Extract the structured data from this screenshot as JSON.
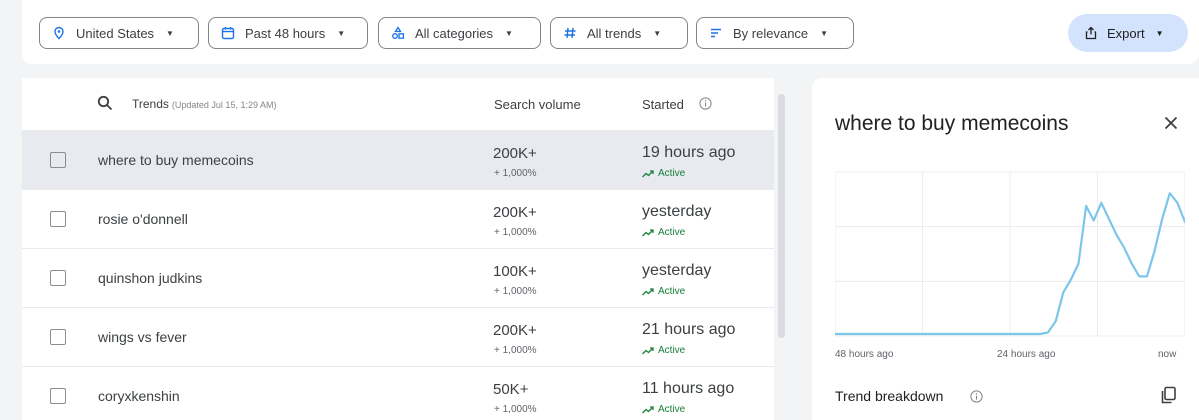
{
  "filters": {
    "location": "United States",
    "time": "Past 48 hours",
    "category": "All categories",
    "trend_type": "All trends",
    "sort": "By relevance",
    "export": "Export"
  },
  "table": {
    "header": {
      "trends": "Trends",
      "updated": "(Updated Jul 15, 1:29 AM)",
      "volume": "Search volume",
      "started": "Started"
    },
    "rows": [
      {
        "term": "where to buy memecoins",
        "volume": "200K+",
        "pct": "+ 1,000%",
        "started": "19 hours ago",
        "status": "Active"
      },
      {
        "term": "rosie o'donnell",
        "volume": "200K+",
        "pct": "+ 1,000%",
        "started": "yesterday",
        "status": "Active"
      },
      {
        "term": "quinshon judkins",
        "volume": "100K+",
        "pct": "+ 1,000%",
        "started": "yesterday",
        "status": "Active"
      },
      {
        "term": "wings vs fever",
        "volume": "200K+",
        "pct": "+ 1,000%",
        "started": "21 hours ago",
        "status": "Active"
      },
      {
        "term": "coryxkenshin",
        "volume": "50K+",
        "pct": "+ 1,000%",
        "started": "11 hours ago",
        "status": "Active"
      }
    ]
  },
  "panel": {
    "title": "where to buy memecoins",
    "x_labels": [
      "48 hours ago",
      "24 hours ago",
      "now"
    ],
    "breakdown_label": "Trend breakdown"
  },
  "chart_data": {
    "type": "line",
    "x_ticks": [
      "48 hours ago",
      "24 hours ago",
      "now"
    ],
    "series": [
      {
        "color": "#7cc6ea",
        "values": [
          0,
          0,
          0,
          0,
          0,
          0,
          0,
          0,
          0,
          0,
          0,
          0,
          0,
          0,
          0,
          0,
          0,
          0,
          0,
          0,
          0,
          0,
          0,
          0,
          0,
          0,
          0,
          0,
          1,
          8,
          26,
          34,
          44,
          80,
          71,
          82,
          72,
          62,
          54,
          44,
          36,
          36,
          52,
          72,
          88,
          82,
          70
        ]
      }
    ],
    "grid": true
  },
  "colors": {
    "accent": "#1a73e8",
    "active_green": "#188038",
    "export_bg": "#d3e3fd",
    "selected_row": "#e8eaf0",
    "line": "#7cc6ea"
  }
}
